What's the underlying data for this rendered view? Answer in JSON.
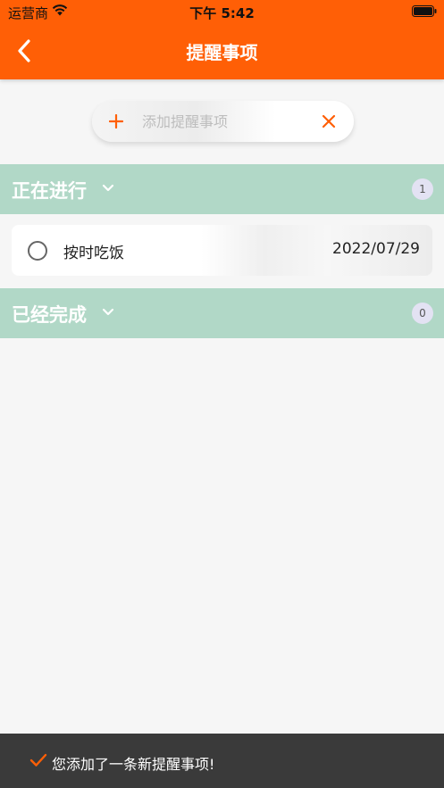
{
  "status_bar": {
    "carrier": "运营商",
    "time": "下午 5:42",
    "wifi_icon": "wifi-icon",
    "battery_icon": "battery-icon"
  },
  "nav": {
    "title": "提醒事项",
    "back_icon": "chevron-left-icon"
  },
  "add_bar": {
    "placeholder": "添加提醒事项",
    "value": "",
    "add_icon": "plus-icon",
    "clear_icon": "close-icon"
  },
  "sections": {
    "in_progress": {
      "title": "正在进行",
      "count": "1",
      "icon": "chevron-down-icon"
    },
    "completed": {
      "title": "已经完成",
      "count": "0",
      "icon": "chevron-down-icon"
    }
  },
  "tasks": [
    {
      "title": "按时吃饭",
      "date": "2022/07/29",
      "done": false
    }
  ],
  "toast": {
    "message": "您添加了一条新提醒事项!",
    "icon": "checkmark-icon"
  },
  "colors": {
    "brand_orange": "#ff5f06",
    "section_green": "#b1d8c7",
    "badge_bg": "#e3e2f3",
    "toast_bg": "#3a3a3a",
    "background": "#f6f6f6"
  }
}
